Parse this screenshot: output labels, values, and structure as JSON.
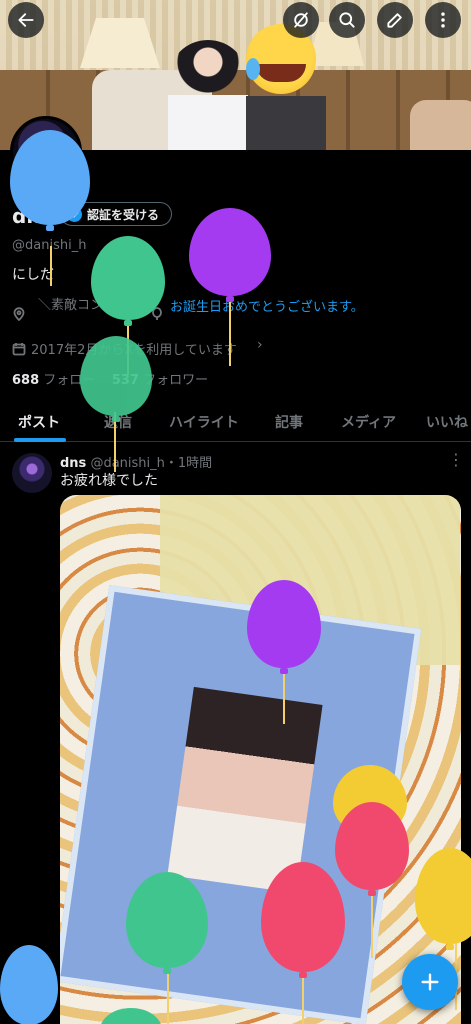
{
  "profile": {
    "name": "dns",
    "verify_label": "認証を受ける",
    "handle": "@danishi_h",
    "bio": "にしだ",
    "location": "＼素敵コンビよし",
    "birthday_message": "お誕生日おめでとうございます。",
    "joined": "2017年2月からXを利用しています",
    "following_count": "688",
    "following_label": "フォロー",
    "followers_count": "537",
    "followers_label": "フォロワー"
  },
  "tabs": [
    {
      "label": "ポスト"
    },
    {
      "label": "返信"
    },
    {
      "label": "ハイライト"
    },
    {
      "label": "記事"
    },
    {
      "label": "メディア"
    },
    {
      "label": "いいね"
    }
  ],
  "post": {
    "author": "dns",
    "handle": "@danishi_h",
    "time": "・1時間",
    "text": "お疲れ様でした"
  },
  "icons": [
    "back-arrow-icon",
    "grok-icon",
    "search-icon",
    "edit-icon",
    "more-icon",
    "verified-check-icon",
    "location-icon",
    "balloon-icon",
    "calendar-icon",
    "plus-icon"
  ],
  "colors": {
    "accent": "#1d9bf0",
    "balloon_blue": "#5aa9f6",
    "balloon_green": "#41c58e",
    "balloon_purple": "#a43bf0",
    "balloon_pink": "#f0496d",
    "balloon_yellow": "#f3cc34"
  }
}
